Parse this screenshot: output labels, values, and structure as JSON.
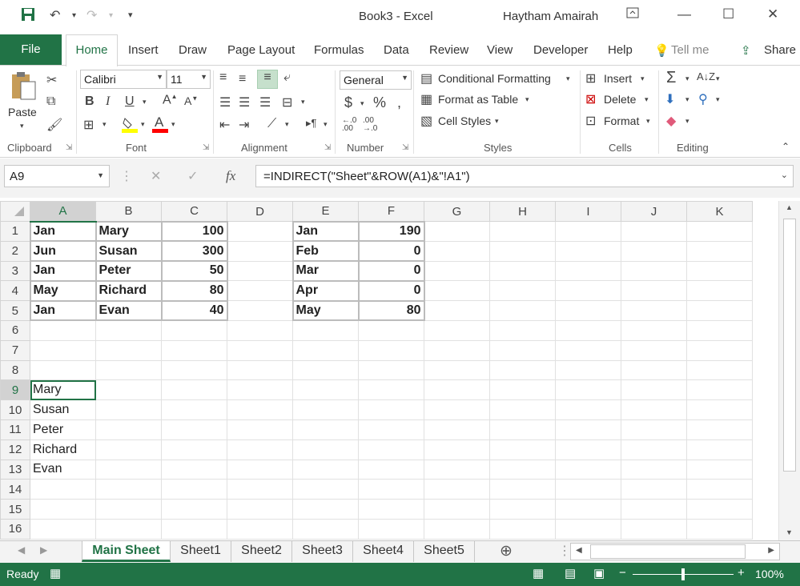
{
  "window": {
    "title": "Book3  -  Excel",
    "user": "Haytham Amairah"
  },
  "ribbon_tabs": [
    "File",
    "Home",
    "Insert",
    "Draw",
    "Page Layout",
    "Formulas",
    "Data",
    "Review",
    "View",
    "Developer",
    "Help",
    "Tell me",
    "Share"
  ],
  "ribbon": {
    "clipboard": {
      "paste": "Paste",
      "label": "Clipboard"
    },
    "font": {
      "name": "Calibri",
      "size": "11",
      "label": "Font"
    },
    "alignment": {
      "label": "Alignment"
    },
    "number": {
      "format": "General",
      "label": "Number"
    },
    "styles": {
      "conditional": "Conditional Formatting",
      "table": "Format as Table",
      "cell_styles": "Cell Styles",
      "label": "Styles"
    },
    "cells": {
      "insert": "Insert",
      "delete": "Delete",
      "format": "Format",
      "label": "Cells"
    },
    "editing": {
      "label": "Editing"
    }
  },
  "formula_bar": {
    "name_box": "A9",
    "formula": "=INDIRECT(\"Sheet\"&ROW(A1)&\"!A1\")"
  },
  "columns": [
    "A",
    "B",
    "C",
    "D",
    "E",
    "F",
    "G",
    "H",
    "I",
    "J",
    "K"
  ],
  "rows": [
    [
      "Jan",
      "Mary",
      "100",
      "",
      "Jan",
      "190",
      "",
      "",
      "",
      "",
      ""
    ],
    [
      "Jun",
      "Susan",
      "300",
      "",
      "Feb",
      "0",
      "",
      "",
      "",
      "",
      ""
    ],
    [
      "Jan",
      "Peter",
      "50",
      "",
      "Mar",
      "0",
      "",
      "",
      "",
      "",
      ""
    ],
    [
      "May",
      "Richard",
      "80",
      "",
      "Apr",
      "0",
      "",
      "",
      "",
      "",
      ""
    ],
    [
      "Jan",
      "Evan",
      "40",
      "",
      "May",
      "80",
      "",
      "",
      "",
      "",
      ""
    ],
    [
      "",
      "",
      "",
      "",
      "",
      "",
      "",
      "",
      "",
      "",
      ""
    ],
    [
      "",
      "",
      "",
      "",
      "",
      "",
      "",
      "",
      "",
      "",
      ""
    ],
    [
      "",
      "",
      "",
      "",
      "",
      "",
      "",
      "",
      "",
      "",
      ""
    ],
    [
      "Mary",
      "",
      "",
      "",
      "",
      "",
      "",
      "",
      "",
      "",
      ""
    ],
    [
      "Susan",
      "",
      "",
      "",
      "",
      "",
      "",
      "",
      "",
      "",
      ""
    ],
    [
      "Peter",
      "",
      "",
      "",
      "",
      "",
      "",
      "",
      "",
      "",
      ""
    ],
    [
      "Richard",
      "",
      "",
      "",
      "",
      "",
      "",
      "",
      "",
      "",
      ""
    ],
    [
      "Evan",
      "",
      "",
      "",
      "",
      "",
      "",
      "",
      "",
      "",
      ""
    ],
    [
      "",
      "",
      "",
      "",
      "",
      "",
      "",
      "",
      "",
      "",
      ""
    ],
    [
      "",
      "",
      "",
      "",
      "",
      "",
      "",
      "",
      "",
      "",
      ""
    ],
    [
      "",
      "",
      "",
      "",
      "",
      "",
      "",
      "",
      "",
      "",
      ""
    ]
  ],
  "sheet_tabs": [
    "Main Sheet",
    "Sheet1",
    "Sheet2",
    "Sheet3",
    "Sheet4",
    "Sheet5"
  ],
  "status": {
    "ready": "Ready",
    "zoom": "100%"
  },
  "colors": {
    "accent": "#217346"
  }
}
